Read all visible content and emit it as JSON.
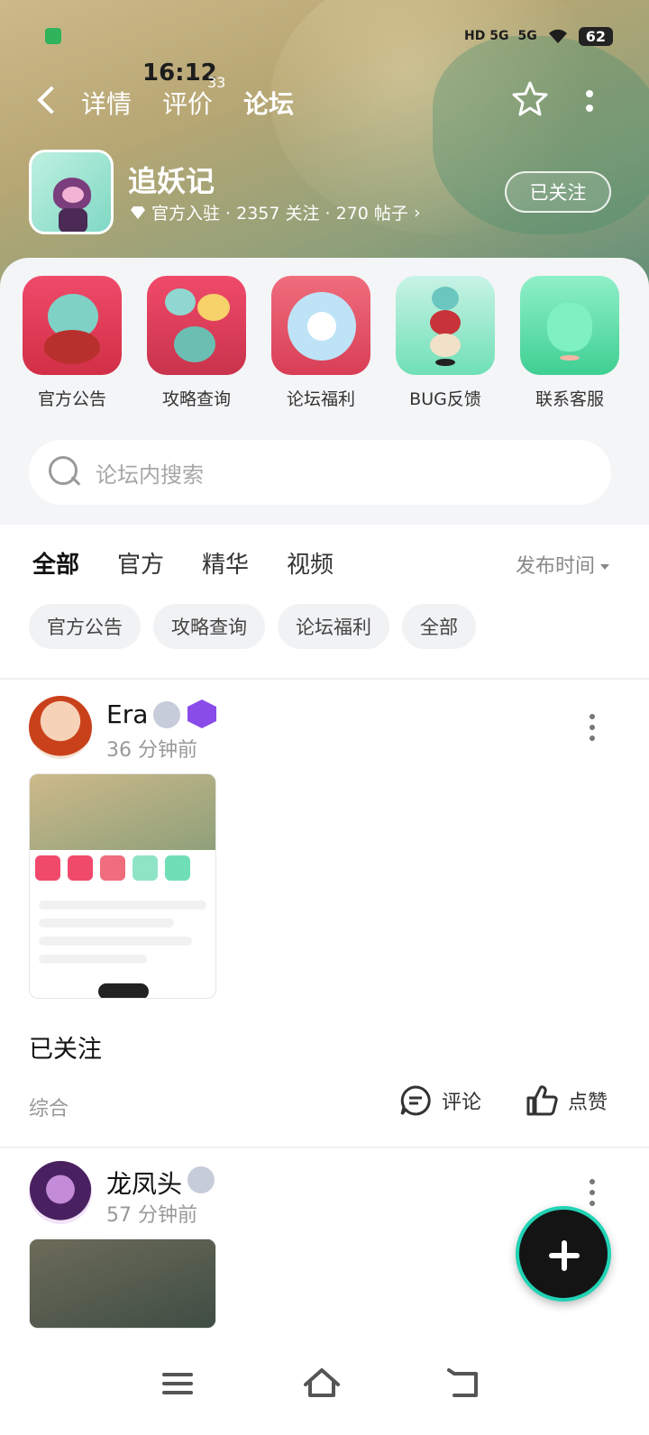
{
  "status": {
    "time": "16:12",
    "signal1": "HD 5G",
    "signal2": "5G",
    "battery": "62"
  },
  "nav": {
    "tabs": [
      "详情",
      "评价",
      "论坛"
    ],
    "review_count": "33"
  },
  "game": {
    "title": "追妖记",
    "meta": "官方入驻 · 2357 关注 · 270 帖子",
    "follow_label": "已关注"
  },
  "shortcuts": [
    {
      "label": "官方公告"
    },
    {
      "label": "攻略查询"
    },
    {
      "label": "论坛福利"
    },
    {
      "label": "BUG反馈"
    },
    {
      "label": "联系客服"
    }
  ],
  "search": {
    "placeholder": "论坛内搜索"
  },
  "filters": {
    "tabs": [
      "全部",
      "官方",
      "精华",
      "视频"
    ],
    "sort": "发布时间",
    "chips": [
      "官方公告",
      "攻略查询",
      "论坛福利",
      "全部"
    ]
  },
  "posts": [
    {
      "user": "Era",
      "time": "36 分钟前",
      "text": "已关注",
      "category": "综合",
      "comment_label": "评论",
      "like_label": "点赞"
    },
    {
      "user": "龙凤头",
      "time": "57 分钟前"
    }
  ],
  "colors": {
    "accent": "#22d3b5"
  }
}
